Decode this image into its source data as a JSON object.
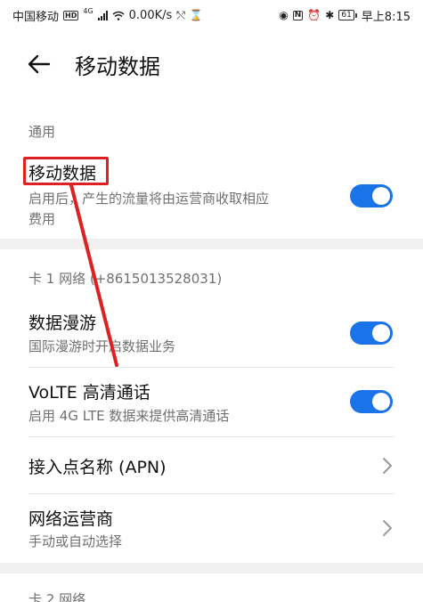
{
  "status_bar": {
    "carrier": "中国移动",
    "hd": "HD",
    "network": "4G",
    "speed": "0.00K/s",
    "battery": "61",
    "time": "早上8:15"
  },
  "header": {
    "title": "移动数据"
  },
  "general": {
    "section_label": "通用",
    "mobile_data": {
      "title": "移动数据",
      "subtitle_line1": "启用后，产生的流量将由运营商收取相应",
      "subtitle_line2": "费用",
      "enabled": true
    }
  },
  "sim1": {
    "section_label": "卡 1 网络 (+8615013528031)",
    "roaming": {
      "title": "数据漫游",
      "subtitle": "国际漫游时开启数据业务",
      "enabled": true
    },
    "volte": {
      "title": "VoLTE 高清通话",
      "subtitle": "启用 4G LTE 数据来提供高清通话",
      "enabled": true
    },
    "apn": {
      "title": "接入点名称 (APN)"
    },
    "operator": {
      "title": "网络运营商",
      "subtitle": "手动或自动选择"
    }
  },
  "sim2": {
    "section_label": "卡 2 网络"
  },
  "colors": {
    "accent": "#1a73e8",
    "annotation": "#e02020"
  }
}
